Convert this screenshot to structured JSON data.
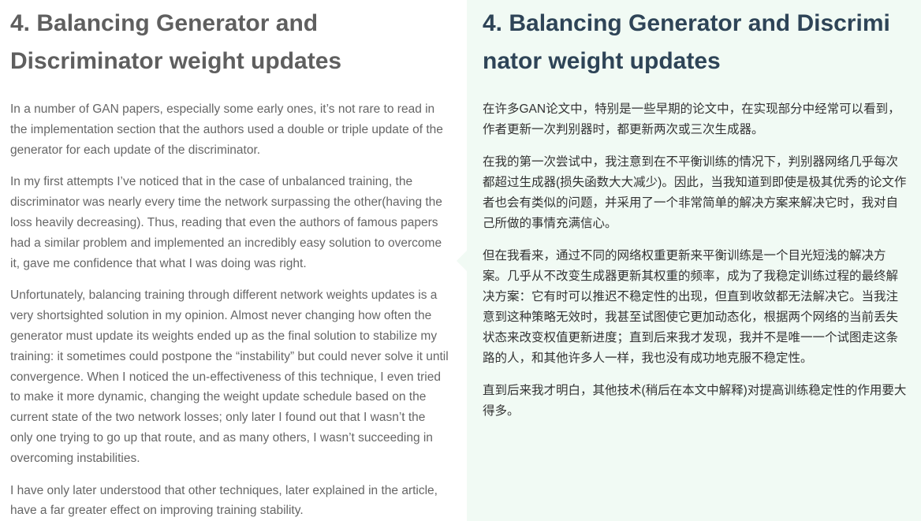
{
  "english": {
    "heading": "4. Balancing Generator and Discriminator weight updates",
    "paragraphs": [
      "In a number of GAN papers, especially some early ones, it’s not rare to read in the implementation section that the authors used a double or triple update of the generator for each update of the discriminator.",
      "In my first attempts I’ve noticed that in the case of unbalanced training, the discriminator was nearly every time the network surpassing the other(having the loss heavily decreasing). Thus, reading that even the authors of famous papers had a similar problem and implemented an incredibly easy solution to overcome it, gave me confidence that what I was doing was right.",
      "Unfortunately, balancing training through different network weights updates is a very shortsighted solution in my opinion. Almost never changing how often the generator must update its weights ended up as the final solution to stabilize my training: it sometimes could postpone the “instability” but could never solve it until convergence. When I noticed the un-effectiveness of this technique, I even tried to make it more dynamic, changing the weight update schedule based on the current state of the two network losses; only later I found out that I wasn’t the only one trying to go up that route, and as many others, I wasn’t succeeding in overcoming instabilities.",
      "I have only later understood that other techniques, later explained in the article, have a far greater effect on improving training stability."
    ]
  },
  "chinese": {
    "heading_lines": [
      "4. Balancing Generator and Discrimi",
      "nator weight updates"
    ],
    "paragraphs": [
      [
        "在许多GAN论文中，特别是一些早期的论文中，在实现部分中经常可以看到，",
        "作者更新一次判别器时，都更新两次或三次生成器。"
      ],
      [
        "在我的第一次尝试中，我注意到在不平衡训练的情况下，判别器网络几乎每次",
        "都超过生成器(损失函数大大减少)。因此，当我知道到即使是极其优秀的论文作",
        "者也会有类似的问题，并采用了一个非常简单的解决方案来解决它时，我对自",
        "己所做的事情充满信心。"
      ],
      [
        "但在我看来，通过不同的网络权重更新来平衡训练是一个目光短浅的解决方",
        "案。几乎从不改变生成器更新其权重的频率，成为了我稳定训练过程的最终解",
        "决方案：它有时可以推迟不稳定性的出现，但直到收敛都无法解决它。当我注",
        "意到这种策略无效时，我甚至试图使它更加动态化，根据两个网络的当前丢失",
        "状态来改变权值更新进度；直到后来我才发现，我并不是唯一一个试图走这条",
        "路的人，和其他许多人一样，我也没有成功地克服不稳定性。"
      ],
      [
        "直到后来我才明白，其他技术(稍后在本文中解释)对提高训练稳定性的作用要大",
        "得多。"
      ]
    ]
  }
}
